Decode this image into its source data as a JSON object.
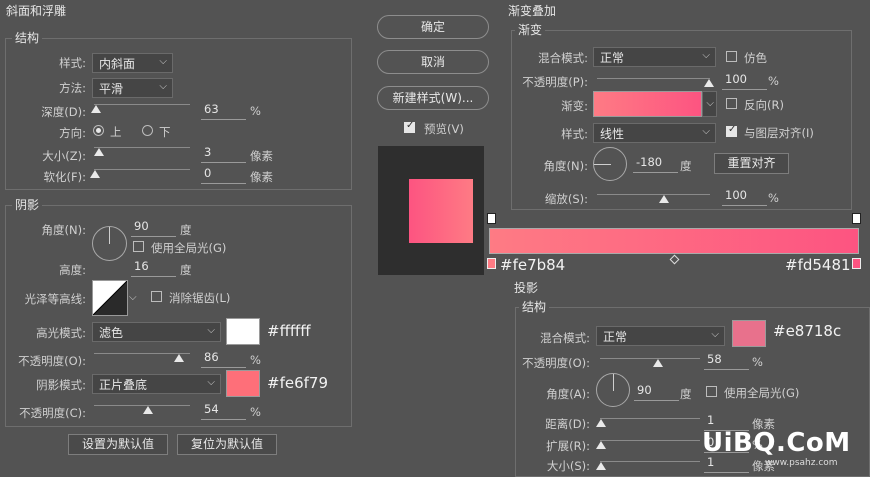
{
  "bevel": {
    "title": "斜面和浮雕",
    "structure_title": "结构",
    "style_label": "样式:",
    "style_value": "内斜面",
    "technique_label": "方法:",
    "technique_value": "平滑",
    "depth_label": "深度(D):",
    "depth_value": "63",
    "depth_unit": "%",
    "depth_pct": 63,
    "direction_label": "方向:",
    "dir_up": "上",
    "dir_down": "下",
    "size_label": "大小(Z):",
    "size_value": "3",
    "size_unit": "像素",
    "soften_label": "软化(F):",
    "soften_value": "0",
    "soften_unit": "像素",
    "shading_title": "阴影",
    "angle_label": "角度(N):",
    "angle_value": "90",
    "angle_unit": "度",
    "global_light": "使用全局光(G)",
    "altitude_label": "高度:",
    "altitude_value": "16",
    "altitude_unit": "度",
    "gloss_label": "光泽等高线:",
    "antialias": "消除锯齿(L)",
    "highlight_mode_label": "高光模式:",
    "highlight_mode_value": "滤色",
    "highlight_color": "#ffffff",
    "highlight_hex": "#ffffff",
    "highlight_opacity_label": "不透明度(O):",
    "highlight_opacity_value": "86",
    "highlight_opacity_unit": "%",
    "shadow_mode_label": "阴影模式:",
    "shadow_mode_value": "正片叠底",
    "shadow_color": "#fe6f79",
    "shadow_hex": "#fe6f79",
    "shadow_opacity_label": "不透明度(C):",
    "shadow_opacity_value": "54",
    "shadow_opacity_unit": "%",
    "set_default": "设置为默认值",
    "reset_default": "复位为默认值"
  },
  "buttons": {
    "ok": "确定",
    "cancel": "取消",
    "new_style": "新建样式(W)...",
    "preview": "预览(V)"
  },
  "gradient_overlay": {
    "title": "渐变叠加",
    "sub_title": "渐变",
    "blend_label": "混合模式:",
    "blend_value": "正常",
    "dither": "仿色",
    "opacity_label": "不透明度(P):",
    "opacity_value": "100",
    "opacity_unit": "%",
    "gradient_label": "渐变:",
    "reverse": "反向(R)",
    "style_label": "样式:",
    "style_value": "线性",
    "align": "与图层对齐(I)",
    "angle_label": "角度(N):",
    "angle_value": "-180",
    "angle_unit": "度",
    "reset_align": "重置对齐",
    "scale_label": "缩放(S):",
    "scale_value": "100",
    "scale_unit": "%",
    "color_left": "#fe7b84",
    "color_right": "#fd5481",
    "stop_left_hex": "#fe7b84",
    "stop_right_hex": "#fd5481"
  },
  "drop_shadow": {
    "title": "投影",
    "structure_title": "结构",
    "blend_label": "混合模式:",
    "blend_value": "正常",
    "color": "#e8718c",
    "hex": "#e8718c",
    "opacity_label": "不透明度(O):",
    "opacity_value": "58",
    "opacity_unit": "%",
    "angle_label": "角度(A):",
    "angle_value": "90",
    "angle_unit": "度",
    "global_light": "使用全局光(G)",
    "distance_label": "距离(D):",
    "distance_value": "1",
    "distance_unit": "像素",
    "spread_label": "扩展(R):",
    "spread_value": "0",
    "spread_unit": "%",
    "size_label": "大小(S):",
    "size_value": "1",
    "size_unit": "像素"
  },
  "watermark": {
    "logo": "UiBQ.CoM",
    "url": "www.psahz.com"
  }
}
